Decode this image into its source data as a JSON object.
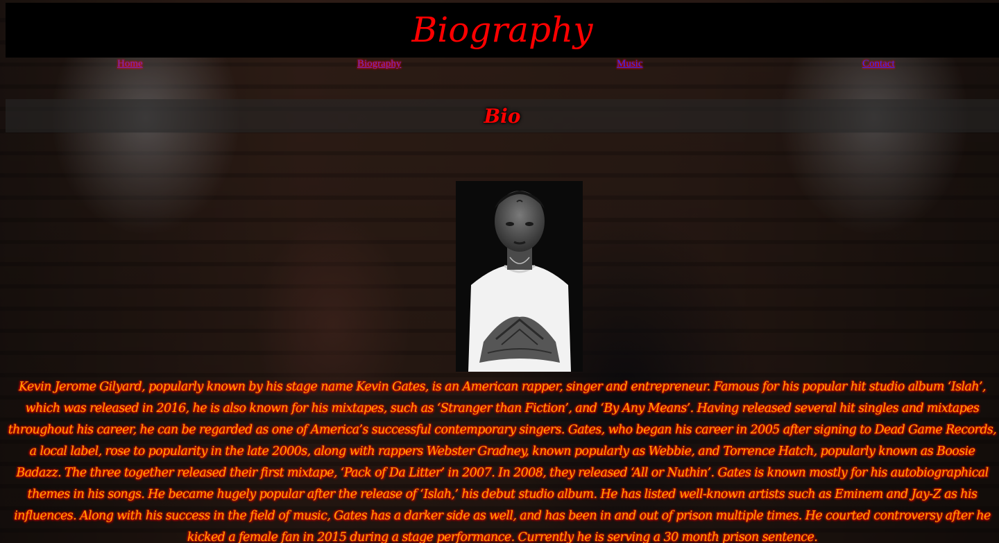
{
  "header": {
    "title": "Biography"
  },
  "nav": {
    "items": [
      {
        "label": "Home"
      },
      {
        "label": "Biography"
      },
      {
        "label": "Music"
      },
      {
        "label": "Contact"
      }
    ]
  },
  "section": {
    "heading": "Bio"
  },
  "portrait": {
    "icon": "artist-portrait-photo"
  },
  "bio": {
    "text": "Kevin Jerome Gilyard, popularly known by his stage name Kevin Gates, is an American rapper, singer and entrepreneur. Famous for his popular hit studio album ‘Islah’, which was released in 2016, he is also known for his mixtapes, such as ‘Stranger than Fiction’, and ‘By Any Means’. Having released several hit singles and mixtapes throughout his career, he can be regarded as one of America’s successful contemporary singers. Gates, who began his career in 2005 after signing to Dead Game Records, a local label, rose to popularity in the late 2000s, along with rappers Webster Gradney, known popularly as Webbie, and Torrence Hatch, popularly known as Boosie Badazz. The three together released their first mixtape, ‘Pack of Da Litter’ in 2007. In 2008, they released ‘All or Nuthin’. Gates is known mostly for his autobiographical themes in his songs. He became hugely popular after the release of ‘Islah,’ his debut studio album. He has listed well-known artists such as Eminem and Jay-Z as his influences. Along with his success in the field of music, Gates has a darker side as well, and has been in and out of prison multiple times. He courted controversy after he kicked a female fan in 2015 during a stage performance. Currently he is serving a 30 month prison sentence."
  },
  "colors": {
    "title": "#ff0000",
    "bio_text": "#ffa500",
    "header_bg": "#000000",
    "link_visited": "#6b2cc6",
    "link_unvisited": "#2a2aff"
  }
}
